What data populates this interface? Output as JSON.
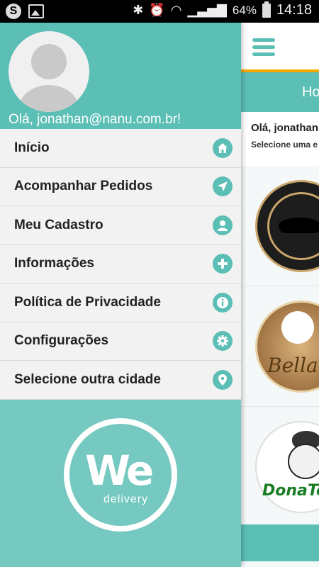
{
  "status_bar": {
    "battery": "64%",
    "time": "14:18"
  },
  "drawer": {
    "greeting": "Olá, jonathan@nanu.com.br!",
    "menu": [
      {
        "label": "Início",
        "icon": "home-icon"
      },
      {
        "label": "Acompanhar Pedidos",
        "icon": "navigation-arrow-icon"
      },
      {
        "label": "Meu Cadastro",
        "icon": "user-icon"
      },
      {
        "label": "Informações",
        "icon": "plus-icon"
      },
      {
        "label": "Política de Privacidade",
        "icon": "info-icon"
      },
      {
        "label": "Configurações",
        "icon": "gear-icon"
      },
      {
        "label": "Selecione outra cidade",
        "icon": "location-pin-icon"
      }
    ],
    "logo": {
      "main": "We",
      "sub": "delivery"
    }
  },
  "background_app": {
    "tab_title": "Ho",
    "greeting": "Olá, jonathan@",
    "subtitle": "Selecione uma e",
    "restaurants": [
      {
        "logo_text": ""
      },
      {
        "logo_text": "Bella"
      },
      {
        "logo_text": "DonaTe"
      }
    ]
  },
  "colors": {
    "teal": "#5bbfb5",
    "teal_light": "#75c9c0",
    "accent_orange": "#f6a800",
    "menu_bg": "#f2f2f2"
  }
}
